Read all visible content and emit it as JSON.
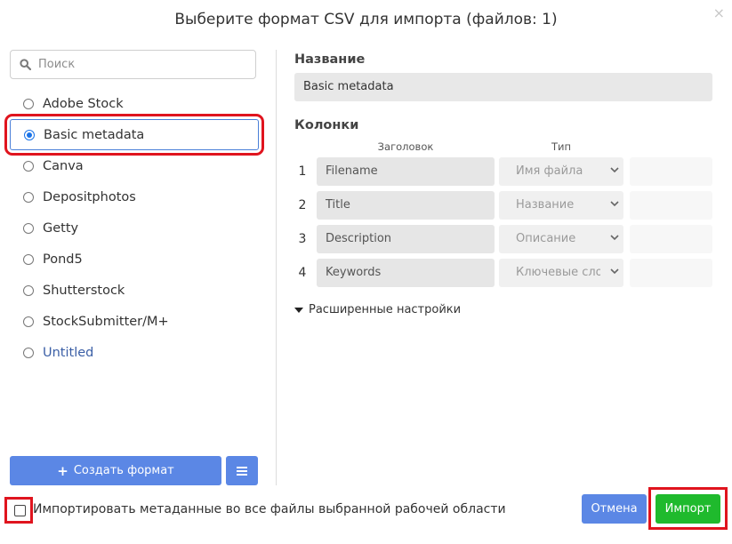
{
  "dialog": {
    "title": "Выберите формат CSV для импорта (файлов: 1)",
    "close_icon": "×"
  },
  "search": {
    "placeholder": "Поиск",
    "value": ""
  },
  "formats": {
    "items": [
      {
        "label": "Adobe Stock",
        "selected": false
      },
      {
        "label": "Basic metadata",
        "selected": true
      },
      {
        "label": "Canva",
        "selected": false
      },
      {
        "label": "Depositphotos",
        "selected": false
      },
      {
        "label": "Getty",
        "selected": false
      },
      {
        "label": "Pond5",
        "selected": false
      },
      {
        "label": "Shutterstock",
        "selected": false
      },
      {
        "label": "StockSubmitter/M+",
        "selected": false
      },
      {
        "label": "Untitled",
        "selected": false
      }
    ]
  },
  "detail": {
    "name_label": "Название",
    "name_value": "Basic metadata",
    "columns_label": "Колонки",
    "header_col": "Заголовок",
    "type_col": "Тип",
    "rows": [
      {
        "num": "1",
        "header": "Filename",
        "type": "Имя файла"
      },
      {
        "num": "2",
        "header": "Title",
        "type": "Название"
      },
      {
        "num": "3",
        "header": "Description",
        "type": "Описание"
      },
      {
        "num": "4",
        "header": "Keywords",
        "type": "Ключевые слова"
      }
    ],
    "advanced_label": "Расширенные настройки"
  },
  "footer": {
    "create_label": "Создать формат",
    "create_icon": "+",
    "checkbox_label": "Импортировать метаданные во все файлы выбранной рабочей области",
    "checkbox_checked": false,
    "cancel_label": "Отмена",
    "import_label": "Импорт"
  },
  "colors": {
    "accent_blue": "#5b87e5",
    "import_green": "#1fba2d",
    "highlight_red": "#e0141e"
  }
}
